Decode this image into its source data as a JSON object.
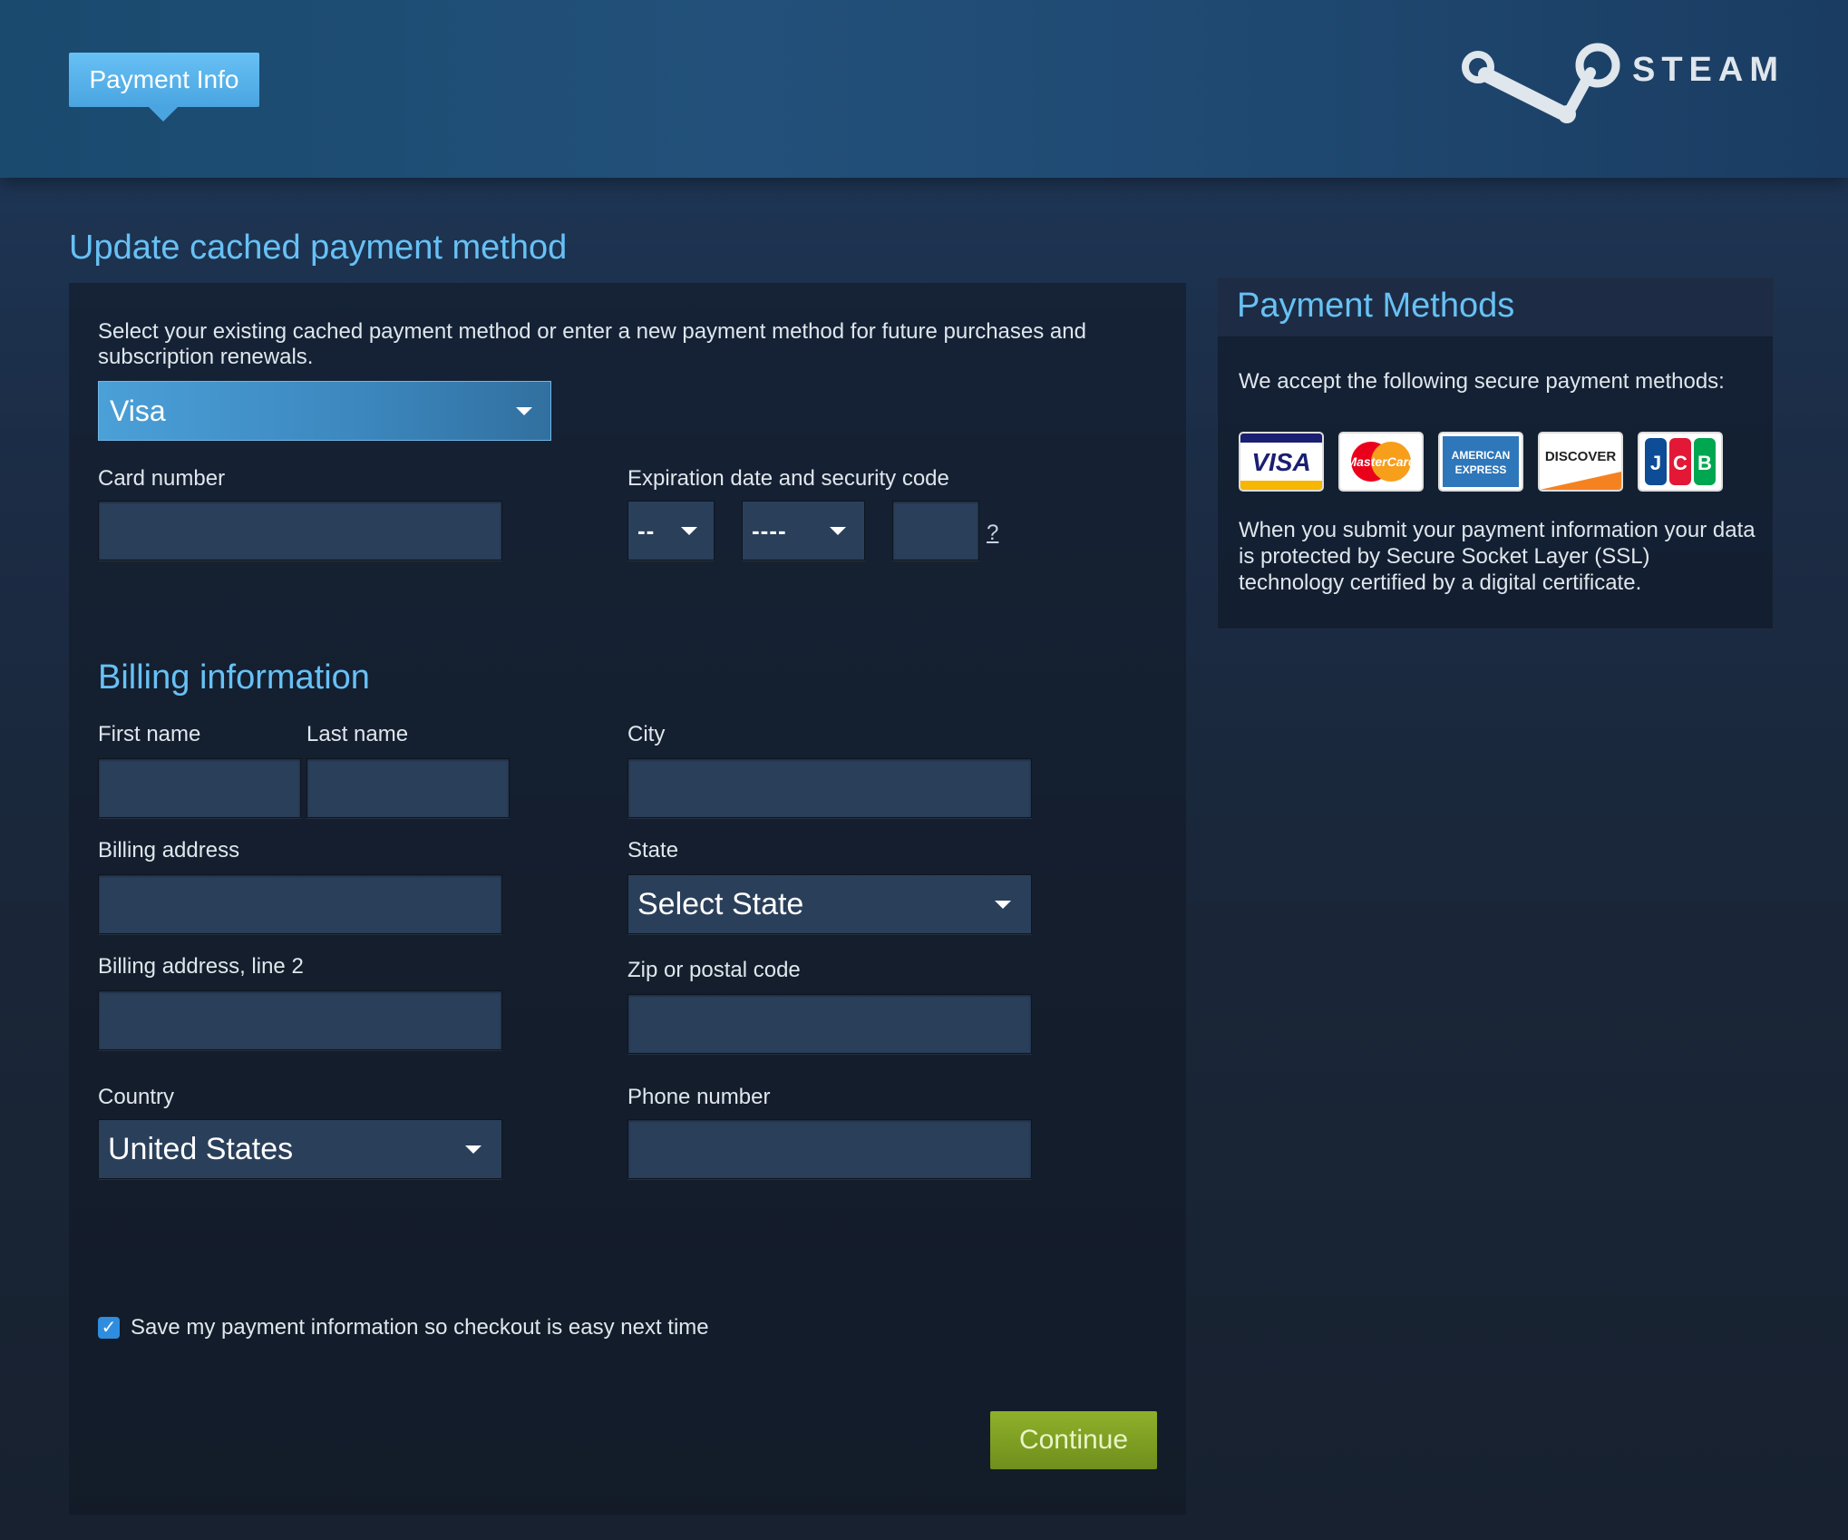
{
  "header": {
    "tab_label": "Payment Info",
    "brand": "STEAM"
  },
  "main": {
    "title": "Update cached payment method",
    "intro": "Select your existing cached payment method or enter a new payment method for future purchases and subscription renewals.",
    "payment_method_selected": "Visa",
    "card_number_label": "Card number",
    "expiration_label": "Expiration date and security code",
    "exp_month_value": "--",
    "exp_year_value": "----",
    "security_help": "?",
    "billing": {
      "title": "Billing information",
      "first_name_label": "First name",
      "last_name_label": "Last name",
      "city_label": "City",
      "address_label": "Billing address",
      "state_label": "State",
      "state_selected": "Select State",
      "address2_label": "Billing address, line 2",
      "zip_label": "Zip or postal code",
      "country_label": "Country",
      "country_selected": "United States",
      "phone_label": "Phone number"
    },
    "save_info_label": "Save my payment information so checkout is easy next time",
    "save_info_checked": true,
    "continue_label": "Continue"
  },
  "sidebar": {
    "title": "Payment Methods",
    "accept_text": "We accept the following secure payment methods:",
    "cards": [
      {
        "name": "visa",
        "label": "VISA"
      },
      {
        "name": "mastercard",
        "label": "MasterCard"
      },
      {
        "name": "american-express",
        "label": "AMERICAN EXPRESS"
      },
      {
        "name": "discover",
        "label": "DISCOVER"
      },
      {
        "name": "jcb",
        "label": "JCB"
      }
    ],
    "ssl_text": "When you submit your payment information your data is protected by Secure Socket Layer (SSL) technology certified by a digital certificate."
  },
  "colors": {
    "accent": "#67c1f5",
    "continue_button": "#7fa024",
    "input_bg": "#2a3f5a"
  }
}
